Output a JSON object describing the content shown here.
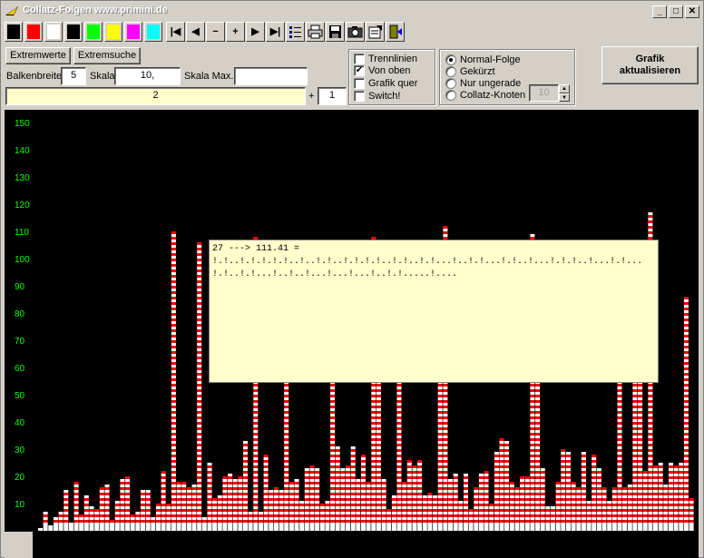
{
  "window": {
    "title": "Collatz-Folgen www.primini.de",
    "minimize": "_",
    "maximize": "□",
    "close": "✕"
  },
  "toolbar": {
    "colors": [
      "#000000",
      "#ff0000",
      "#ffffff",
      "#000000",
      "#00ff00",
      "#ffff00",
      "#ff00ff",
      "#00ffff"
    ],
    "nav_first": "|◀",
    "nav_prev": "◀",
    "minus": "−",
    "plus": "+",
    "nav_next": "▶",
    "nav_last": "▶|"
  },
  "controls": {
    "extremwerte_label": "Extremwerte",
    "extremsuche_label": "Extremsuche",
    "balkenbreite_label": "Balkenbreite",
    "balkenbreite_value": "5",
    "skala_label": "Skala",
    "skala_value": "10,",
    "skala_max_label": "Skala Max.",
    "skala_max_value": "",
    "start_value": "2",
    "plus_sign": "+",
    "step_value": "1"
  },
  "options": {
    "trennlinien": {
      "label": "Trennlinien",
      "checked": false
    },
    "von_oben": {
      "label": "Von oben",
      "checked": true
    },
    "grafik_quer": {
      "label": "Grafik quer",
      "checked": false
    },
    "switch": {
      "label": "Switch!",
      "checked": false
    }
  },
  "mode": {
    "normal": "Normal-Folge",
    "gekuerzt": "Gekürzt",
    "ungerade": "Nur ungerade",
    "knoten": "Collatz-Knoten",
    "knoten_value": "10",
    "selected": "normal"
  },
  "update_button": {
    "line1": "Grafik",
    "line2": "aktualisieren"
  },
  "chart_data": {
    "type": "bar",
    "y_ticks": [
      "150",
      "140",
      "130",
      "120",
      "110",
      "100",
      "90",
      "80",
      "70",
      "60",
      "50",
      "40",
      "30",
      "20",
      "10"
    ],
    "ylim": [
      0,
      150
    ],
    "colors": {
      "tick": "#00ff00",
      "bar_a": "#ff0000",
      "bar_b": "#ffffff",
      "background": "#000000"
    },
    "values": [
      1,
      7,
      2,
      5,
      7,
      15,
      3,
      18,
      6,
      13,
      9,
      8,
      16,
      17,
      4,
      11,
      19,
      20,
      6,
      7,
      15,
      15,
      5,
      10,
      22,
      10,
      110,
      18,
      18,
      16,
      17,
      106,
      5,
      25,
      12,
      13,
      20,
      21,
      19,
      20,
      33,
      7,
      108,
      7,
      28,
      15,
      16,
      15,
      100,
      18,
      19,
      11,
      23,
      24,
      23,
      10,
      11,
      103,
      31,
      23,
      24,
      31,
      19,
      28,
      18,
      108,
      106,
      19,
      8,
      13,
      107,
      18,
      26,
      24,
      26,
      13,
      14,
      13,
      90,
      112,
      19,
      21,
      11,
      21,
      8,
      16,
      21,
      22,
      10,
      29,
      34,
      33,
      18,
      16,
      20,
      20,
      109,
      106,
      23,
      9,
      9,
      18,
      30,
      29,
      18,
      16,
      29,
      11,
      28,
      23,
      16,
      11,
      16,
      89,
      16,
      17,
      102,
      99,
      22,
      117,
      24,
      25,
      17,
      25,
      24,
      25,
      86,
      12
    ]
  },
  "tooltip": {
    "line1": "27 ---> 111.41 =",
    "line2": "!.!..!.!.!.!.!..!..!.!..!.!.!.!..!.!..!.!...!..!.!...!.!..!...!.!.!..!...!.!...",
    "line3": "!.!..!.!...!..!..!...!...!...!..!.!.....!...."
  }
}
